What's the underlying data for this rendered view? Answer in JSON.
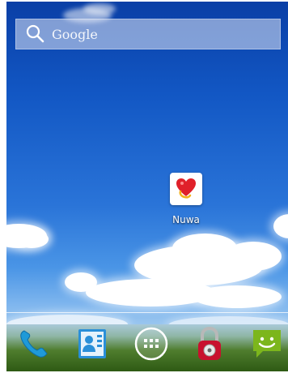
{
  "search": {
    "label": "Google",
    "icon": "search-icon"
  },
  "desktop": {
    "shortcuts": [
      {
        "label": "Nuwa",
        "icon": "heart-bubble-icon"
      }
    ]
  },
  "dock": {
    "items": [
      {
        "icon": "phone-icon"
      },
      {
        "icon": "contacts-icon"
      },
      {
        "icon": "app-drawer-icon"
      },
      {
        "icon": "padlock-icon"
      },
      {
        "icon": "messaging-icon"
      }
    ]
  },
  "colors": {
    "sky_top": "#0a3fa6",
    "sky_bottom": "#9cc7ef",
    "messaging_green": "#7cb61c",
    "padlock_red": "#c8102e"
  }
}
